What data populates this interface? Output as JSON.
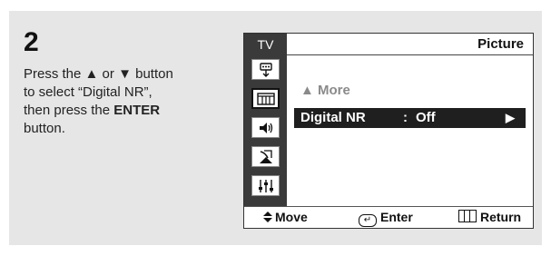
{
  "step": {
    "number": "2"
  },
  "instructions": {
    "line1_pre": "Press the ",
    "up_arrow": "▲",
    "line1_mid": " or ",
    "down_arrow": "▼",
    "line1_post": " button",
    "line2": "to select “Digital NR”,",
    "line3_pre": "then press the ",
    "enter_word": "ENTER",
    "line4": "button."
  },
  "osd": {
    "source_label": "TV",
    "title": "Picture",
    "sidebar_icons": [
      "input-icon",
      "picture-icon",
      "sound-icon",
      "channel-icon",
      "setup-icon"
    ],
    "sidebar_active": "picture-icon",
    "more_label": "▲ More",
    "selected_item": {
      "label": "Digital NR",
      "separator": ":",
      "value": "Off",
      "arrow": "▶"
    },
    "footer": {
      "move": "Move",
      "enter": "Enter",
      "return": "Return"
    }
  }
}
